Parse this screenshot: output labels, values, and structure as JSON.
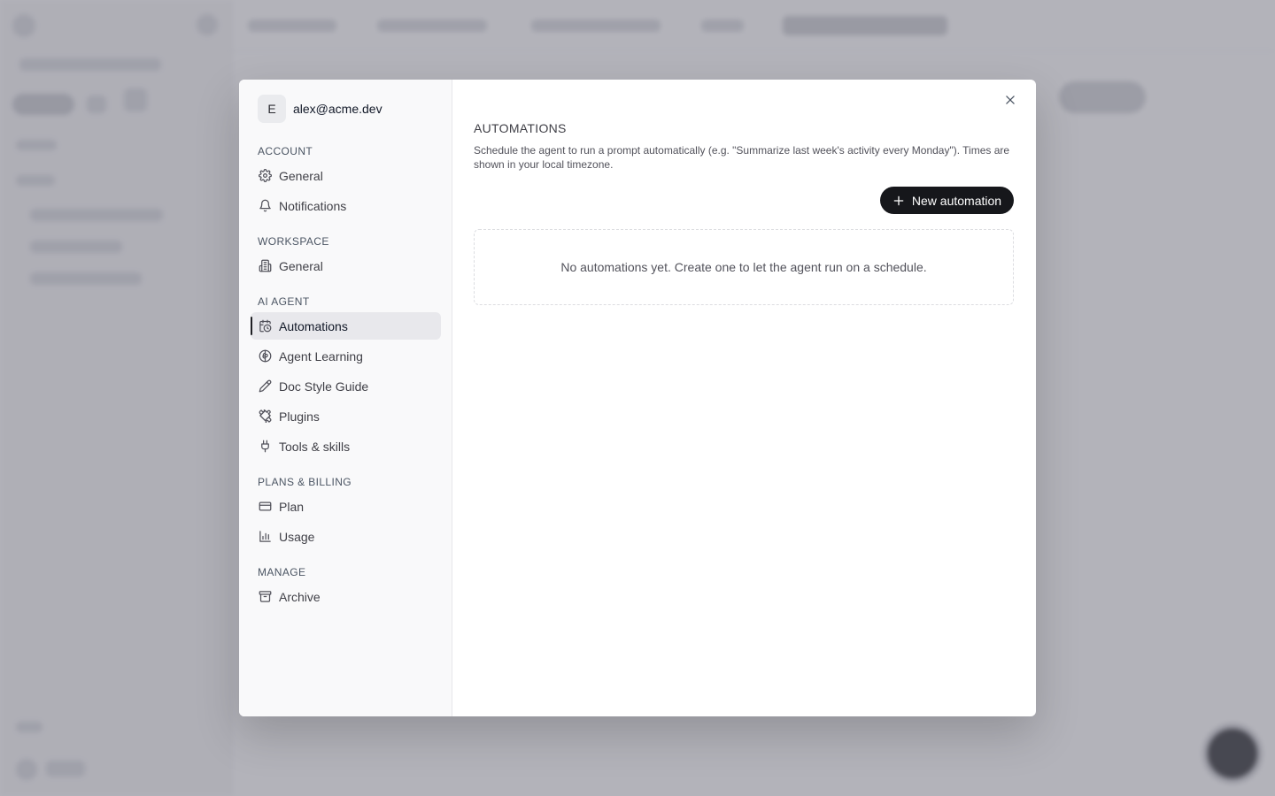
{
  "user": {
    "avatar_initial": "E",
    "email": "alex@acme.dev"
  },
  "nav": {
    "sections": [
      {
        "label": "ACCOUNT",
        "items": [
          {
            "label": "General",
            "icon": "gear-icon"
          },
          {
            "label": "Notifications",
            "icon": "bell-icon"
          }
        ]
      },
      {
        "label": "WORKSPACE",
        "items": [
          {
            "label": "General",
            "icon": "building-icon"
          }
        ]
      },
      {
        "label": "AI AGENT",
        "items": [
          {
            "label": "Automations",
            "icon": "calendar-clock-icon",
            "active": true
          },
          {
            "label": "Agent Learning",
            "icon": "brain-icon"
          },
          {
            "label": "Doc Style Guide",
            "icon": "pen-icon"
          },
          {
            "label": "Plugins",
            "icon": "puzzle-icon"
          },
          {
            "label": "Tools & skills",
            "icon": "plug-icon"
          }
        ]
      },
      {
        "label": "PLANS & BILLING",
        "items": [
          {
            "label": "Plan",
            "icon": "credit-card-icon"
          },
          {
            "label": "Usage",
            "icon": "bar-chart-icon"
          }
        ]
      },
      {
        "label": "MANAGE",
        "items": [
          {
            "label": "Archive",
            "icon": "archive-icon"
          }
        ]
      }
    ]
  },
  "main": {
    "title": "AUTOMATIONS",
    "description": "Schedule the agent to run a prompt automatically (e.g. \"Summarize last week's activity every Monday\"). Times are shown in your local timezone.",
    "new_button_label": "New automation",
    "empty_state": "No automations yet. Create one to let the agent run on a schedule."
  },
  "colors": {
    "accent": "#16171b",
    "overlay": "#6e6e7a"
  }
}
